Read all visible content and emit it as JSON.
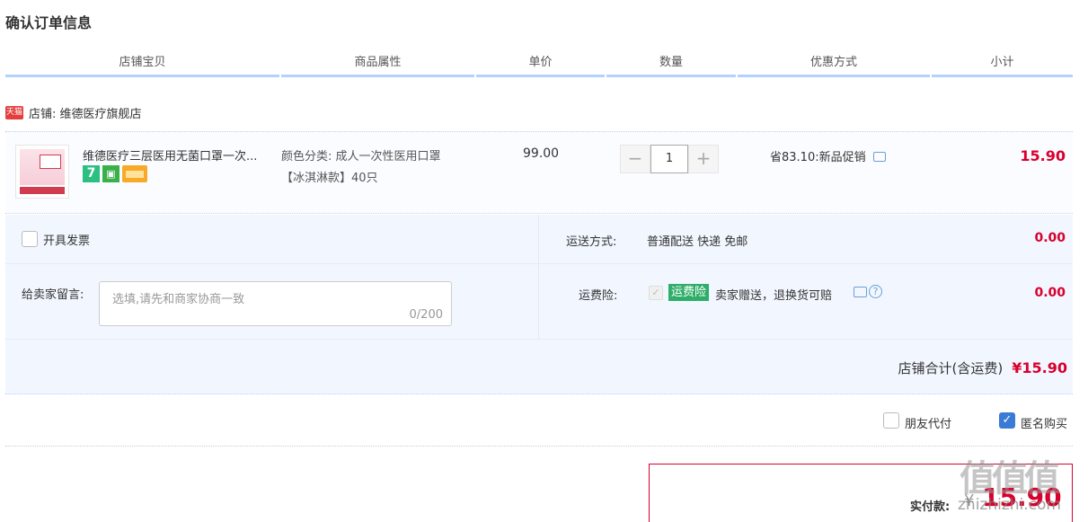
{
  "page": {
    "title": "确认订单信息"
  },
  "columns": [
    "店铺宝贝",
    "商品属性",
    "单价",
    "数量",
    "优惠方式",
    "小计"
  ],
  "shop": {
    "badge": "天猫",
    "label": "店铺: 维德医疗旗舰店"
  },
  "item": {
    "title": "维德医疗三层医用无菌口罩一次...",
    "attr_line1": "颜色分类: 成人一次性医用口罩",
    "attr_line2": "【冰淇淋款】40只",
    "price": "99.00",
    "quantity": "1",
    "qty_minus": "−",
    "qty_plus": "+",
    "promo": "省83.10:新品促销",
    "subtotal": "15.90",
    "service_icons": [
      "seven-day-return-icon",
      "guarantee-icon",
      "credit-card-icon"
    ]
  },
  "options": {
    "invoice_label": "开具发票",
    "shipping_label": "运送方式:",
    "shipping_value": "普通配送 快递 免邮",
    "shipping_fee": "0.00",
    "message_label": "给卖家留言:",
    "message_placeholder": "选填,请先和商家协商一致",
    "message_count": "0/200",
    "insurance_label": "运费险:",
    "insurance_tag": "运费险",
    "insurance_text": "卖家赠送，退换货可赔",
    "insurance_fee": "0.00",
    "store_total_label": "店铺合计(含运费)",
    "store_total_value": "¥15.90"
  },
  "footer": {
    "friend_pay_label": "朋友代付",
    "anonymous_label": "匿名购买",
    "anonymous_checked": true,
    "pay_label": "实付款:",
    "pay_yen": "¥",
    "pay_amount": "15.90"
  },
  "watermark": {
    "logo": "值值值",
    "text": "zhizhizhi.com"
  },
  "colors": {
    "accent_red": "#d8002c",
    "header_line": "#b2d1ff",
    "panel_bg": "#f2f7ff",
    "insurance_green": "#2eae68",
    "check_blue": "#3a7bd5"
  }
}
